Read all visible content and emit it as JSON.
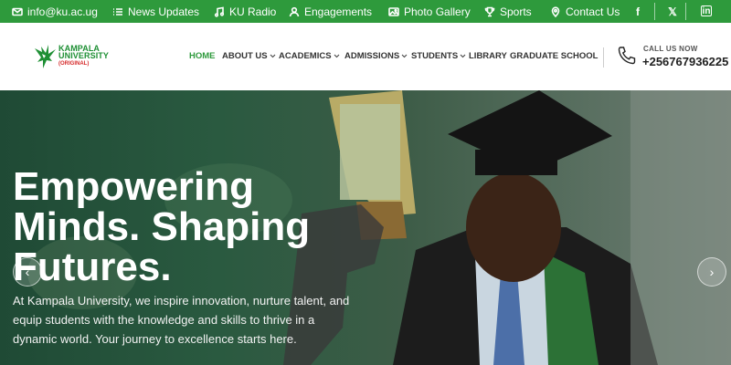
{
  "topbar": {
    "email": "info@ku.ac.ug",
    "news": "News Updates",
    "radio": "KU Radio",
    "engagements": "Engagements",
    "gallery": "Photo Gallery",
    "sports": "Sports",
    "contact": "Contact Us",
    "social": [
      "f",
      "𝕏",
      "in"
    ]
  },
  "logo": {
    "line1": "KAMPALA",
    "line2": "UNIVERSITY",
    "tag": "(ORIGINAL)"
  },
  "nav": [
    {
      "label": "HOME",
      "active": true,
      "dropdown": false
    },
    {
      "label": "ABOUT US",
      "active": false,
      "dropdown": true
    },
    {
      "label": "ACADEMICS",
      "active": false,
      "dropdown": true
    },
    {
      "label": "ADMISSIONS",
      "active": false,
      "dropdown": true
    },
    {
      "label": "STUDENTS",
      "active": false,
      "dropdown": true
    },
    {
      "label": "LIBRARY",
      "active": false,
      "dropdown": false
    },
    {
      "label": "GRADUATE SCHOOL",
      "active": false,
      "dropdown": false
    }
  ],
  "call": {
    "label": "CALL US NOW",
    "number": "+256767936225"
  },
  "hero": {
    "title_line1": "Empowering",
    "title_line2": "Minds. Shaping",
    "title_line3": "Futures.",
    "description": "At Kampala University, we inspire innovation, nurture talent, and equip students with the knowledge and skills to thrive in a dynamic world. Your journey to excellence starts here.",
    "prev": "‹",
    "next": "›"
  },
  "colors": {
    "brand_green": "#2e9a3c",
    "accent_red": "#d62a2a"
  }
}
